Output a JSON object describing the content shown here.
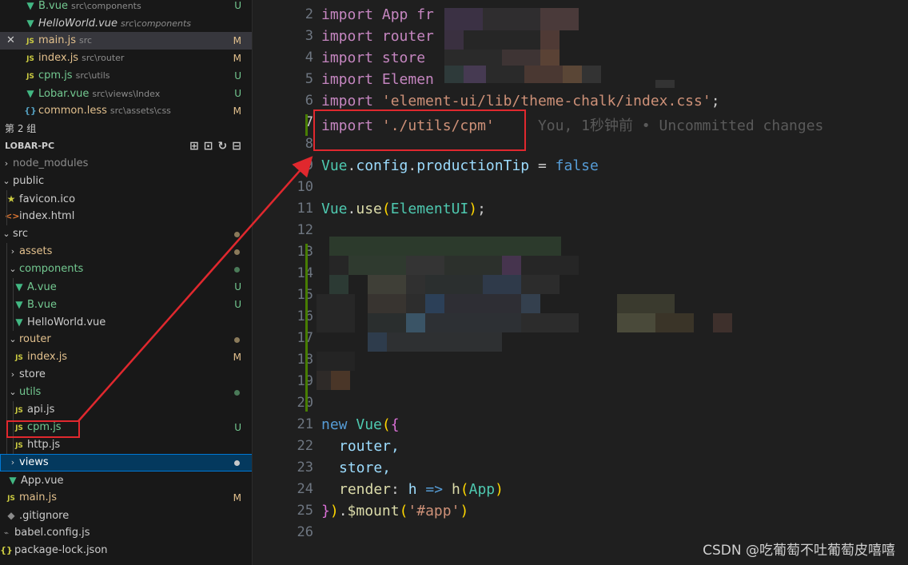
{
  "explorer": {
    "open_editors": [
      {
        "name": "B.vue",
        "path": "src\\components",
        "badge": "U",
        "icon": "vue-icon"
      },
      {
        "name": "HelloWorld.vue",
        "path": "src\\components",
        "badge": "",
        "icon": "vue-icon"
      },
      {
        "name": "main.js",
        "path": "src",
        "badge": "M",
        "icon": "js-icon"
      },
      {
        "name": "index.js",
        "path": "src\\router",
        "badge": "M",
        "icon": "js-icon"
      },
      {
        "name": "cpm.js",
        "path": "src\\utils",
        "badge": "U",
        "icon": "js-icon"
      },
      {
        "name": "Lobar.vue",
        "path": "src\\views\\Index",
        "badge": "U",
        "icon": "vue-icon"
      },
      {
        "name": "common.less",
        "path": "src\\assets\\css",
        "badge": "M",
        "icon": "less-icon"
      }
    ],
    "group_label": "第 2 组",
    "project_title": "LOBAR-PC",
    "tree": [
      {
        "name": "node_modules",
        "badge": ""
      },
      {
        "name": "public",
        "badge": ""
      },
      {
        "name": "favicon.ico",
        "badge": ""
      },
      {
        "name": "index.html",
        "badge": ""
      },
      {
        "name": "src",
        "badge": ""
      },
      {
        "name": "assets",
        "badge": ""
      },
      {
        "name": "components",
        "badge": ""
      },
      {
        "name": "A.vue",
        "badge": "U"
      },
      {
        "name": "B.vue",
        "badge": "U"
      },
      {
        "name": "HelloWorld.vue",
        "badge": ""
      },
      {
        "name": "router",
        "badge": ""
      },
      {
        "name": "index.js",
        "badge": "M"
      },
      {
        "name": "store",
        "badge": ""
      },
      {
        "name": "utils",
        "badge": ""
      },
      {
        "name": "api.js",
        "badge": ""
      },
      {
        "name": "cpm.js",
        "badge": "U"
      },
      {
        "name": "http.js",
        "badge": ""
      },
      {
        "name": "views",
        "badge": ""
      },
      {
        "name": "App.vue",
        "badge": ""
      },
      {
        "name": "main.js",
        "badge": "M"
      },
      {
        "name": ".gitignore",
        "badge": ""
      },
      {
        "name": "babel.config.js",
        "badge": ""
      },
      {
        "name": "package-lock.json",
        "badge": ""
      }
    ],
    "icons": {
      "js": "JS",
      "vue": "▼",
      "less": "{}",
      "json": "{}",
      "html": "<>",
      "star": "★",
      "close": "✕",
      "chev_right": "›",
      "chev_down": "⌄"
    }
  },
  "editor": {
    "line_numbers": [
      "2",
      "3",
      "4",
      "5",
      "6",
      "7",
      "8",
      "9",
      "10",
      "11",
      "12",
      "13",
      "14",
      "15",
      "16",
      "17",
      "18",
      "19",
      "20",
      "21",
      "22",
      "23",
      "24",
      "25",
      "26"
    ],
    "lines": {
      "l2": "import App fr",
      "l3": "import router",
      "l4": "import store",
      "l5": "import Elemen",
      "l6_kw": "import",
      "l6_str": "'element-ui/lib/theme-chalk/index.css'",
      "l7_kw": "import",
      "l7_str": "'./utils/cpm'",
      "l7_blame": "You, 1秒钟前 • Uncommitted changes",
      "l9_obj": "Vue",
      "l9_prop1": "config",
      "l9_prop2": "productionTip",
      "l9_val": "false",
      "l11_obj": "Vue",
      "l11_fn": "use",
      "l11_arg": "ElementUI",
      "l21_new": "new",
      "l21_cls": "Vue",
      "l22": "router,",
      "l23": "store,",
      "l24_key": "render",
      "l24_param": "h",
      "l24_fn": "h",
      "l24_arg": "App",
      "l25_fn": "$mount",
      "l25_str": "'#app'"
    }
  },
  "watermark": "CSDN @吃葡萄不吐葡萄皮嘻嘻",
  "colors": {
    "annotation": "#e0282e",
    "untracked": "#73c991",
    "modified": "#e2c08d"
  }
}
